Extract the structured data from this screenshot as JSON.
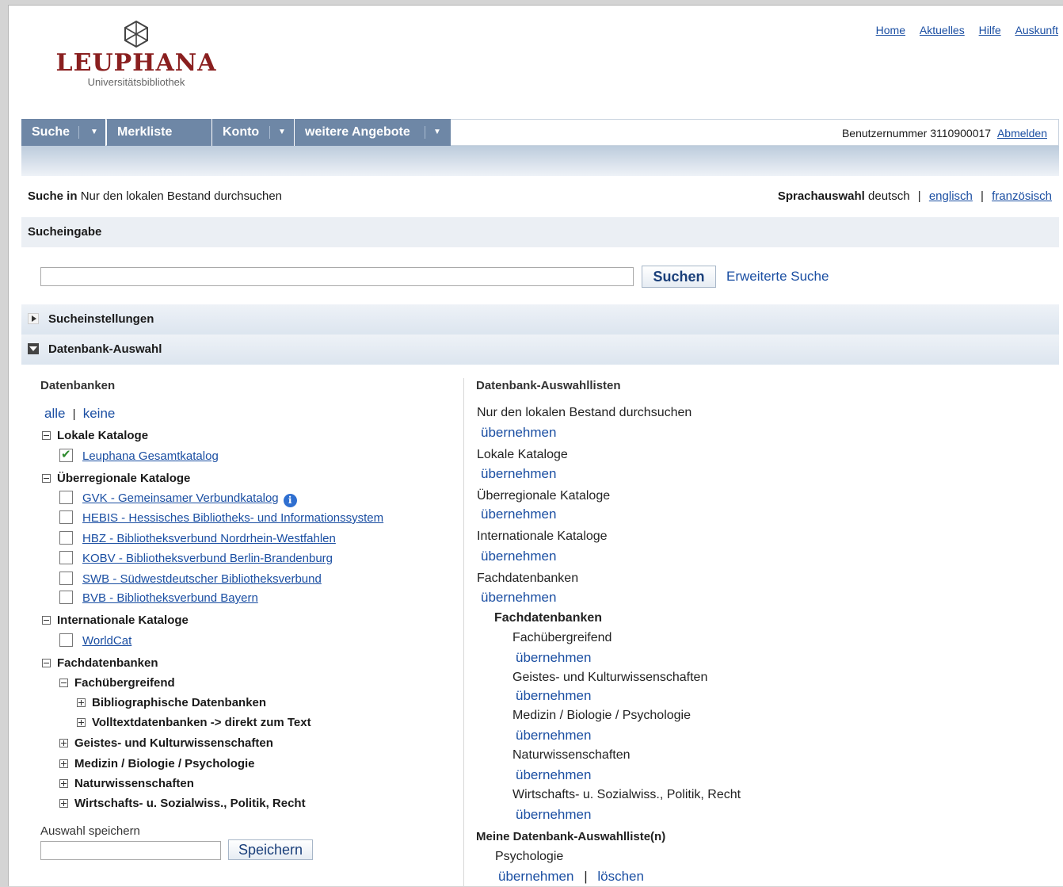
{
  "header": {
    "logo_word": "LEUPHANA",
    "logo_sub": "Universitätsbibliothek",
    "top_links": [
      "Home",
      "Aktuelles",
      "Hilfe",
      "Auskunft"
    ]
  },
  "nav": {
    "items": [
      "Suche",
      "Merkliste",
      "Konto",
      "weitere Angebote"
    ],
    "user_text": "Benutzernummer 3110900017",
    "logout": "Abmelden"
  },
  "search_scope": {
    "label": "Suche in",
    "value": "Nur den lokalen Bestand durchsuchen"
  },
  "language": {
    "label": "Sprachauswahl",
    "current": "deutsch",
    "sep": "|",
    "options": [
      "englisch",
      "französisch"
    ]
  },
  "search": {
    "section_title": "Sucheingabe",
    "input_value": "",
    "button": "Suchen",
    "advanced": "Erweiterte Suche"
  },
  "sections": {
    "settings": "Sucheinstellungen",
    "db_select": "Datenbank-Auswahl"
  },
  "databases": {
    "title": "Datenbanken",
    "all": "alle",
    "sep": "|",
    "none": "keine",
    "local_group": "Lokale Kataloge",
    "local_items": [
      {
        "label": "Leuphana Gesamtkatalog",
        "checked": true
      }
    ],
    "regional_group": "Überregionale Kataloge",
    "regional_items": [
      {
        "label": "GVK - Gemeinsamer Verbundkatalog",
        "checked": false
      },
      {
        "label": "HEBIS - Hessisches Bibliotheks- und Informationssystem",
        "checked": false
      },
      {
        "label": "HBZ - Bibliotheksverbund Nordrhein-Westfahlen",
        "checked": false
      },
      {
        "label": "KOBV - Bibliotheksverbund Berlin-Brandenburg",
        "checked": false
      },
      {
        "label": "SWB - Südwestdeutscher Bibliotheksverbund",
        "checked": false
      },
      {
        "label": "BVB - Bibliotheksverbund Bayern",
        "checked": false
      }
    ],
    "intl_group": "Internationale Kataloge",
    "intl_items": [
      {
        "label": "WorldCat",
        "checked": false
      }
    ],
    "fach_group": "Fachdatenbanken",
    "fach_sub": "Fachübergreifend",
    "fach_sub_items": [
      "Bibliographische Datenbanken",
      "Volltextdatenbanken -> direkt zum Text"
    ],
    "fach_more": [
      "Geistes- und Kulturwissenschaften",
      "Medizin / Biologie / Psychologie",
      "Naturwissenschaften",
      "Wirtschafts- u. Sozialwiss., Politik, Recht"
    ],
    "save_label": "Auswahl speichern",
    "save_input": "",
    "save_button": "Speichern"
  },
  "lists": {
    "title": "Datenbank-Auswahllisten",
    "apply": "übernehmen",
    "items": [
      "Nur den lokalen Bestand durchsuchen",
      "Lokale Kataloge",
      "Überregionale Kataloge",
      "Internationale Kataloge",
      "Fachdatenbanken"
    ],
    "sub_title": "Fachdatenbanken",
    "sub_items": [
      "Fachübergreifend",
      "Geistes- und Kulturwissenschaften",
      "Medizin / Biologie / Psychologie",
      "Naturwissenschaften",
      "Wirtschafts- u. Sozialwiss., Politik, Recht"
    ],
    "mine_title": "Meine Datenbank-Auswahlliste(n)",
    "mine_items": [
      "Psychologie"
    ],
    "mine_sep": "|",
    "delete": "löschen"
  }
}
